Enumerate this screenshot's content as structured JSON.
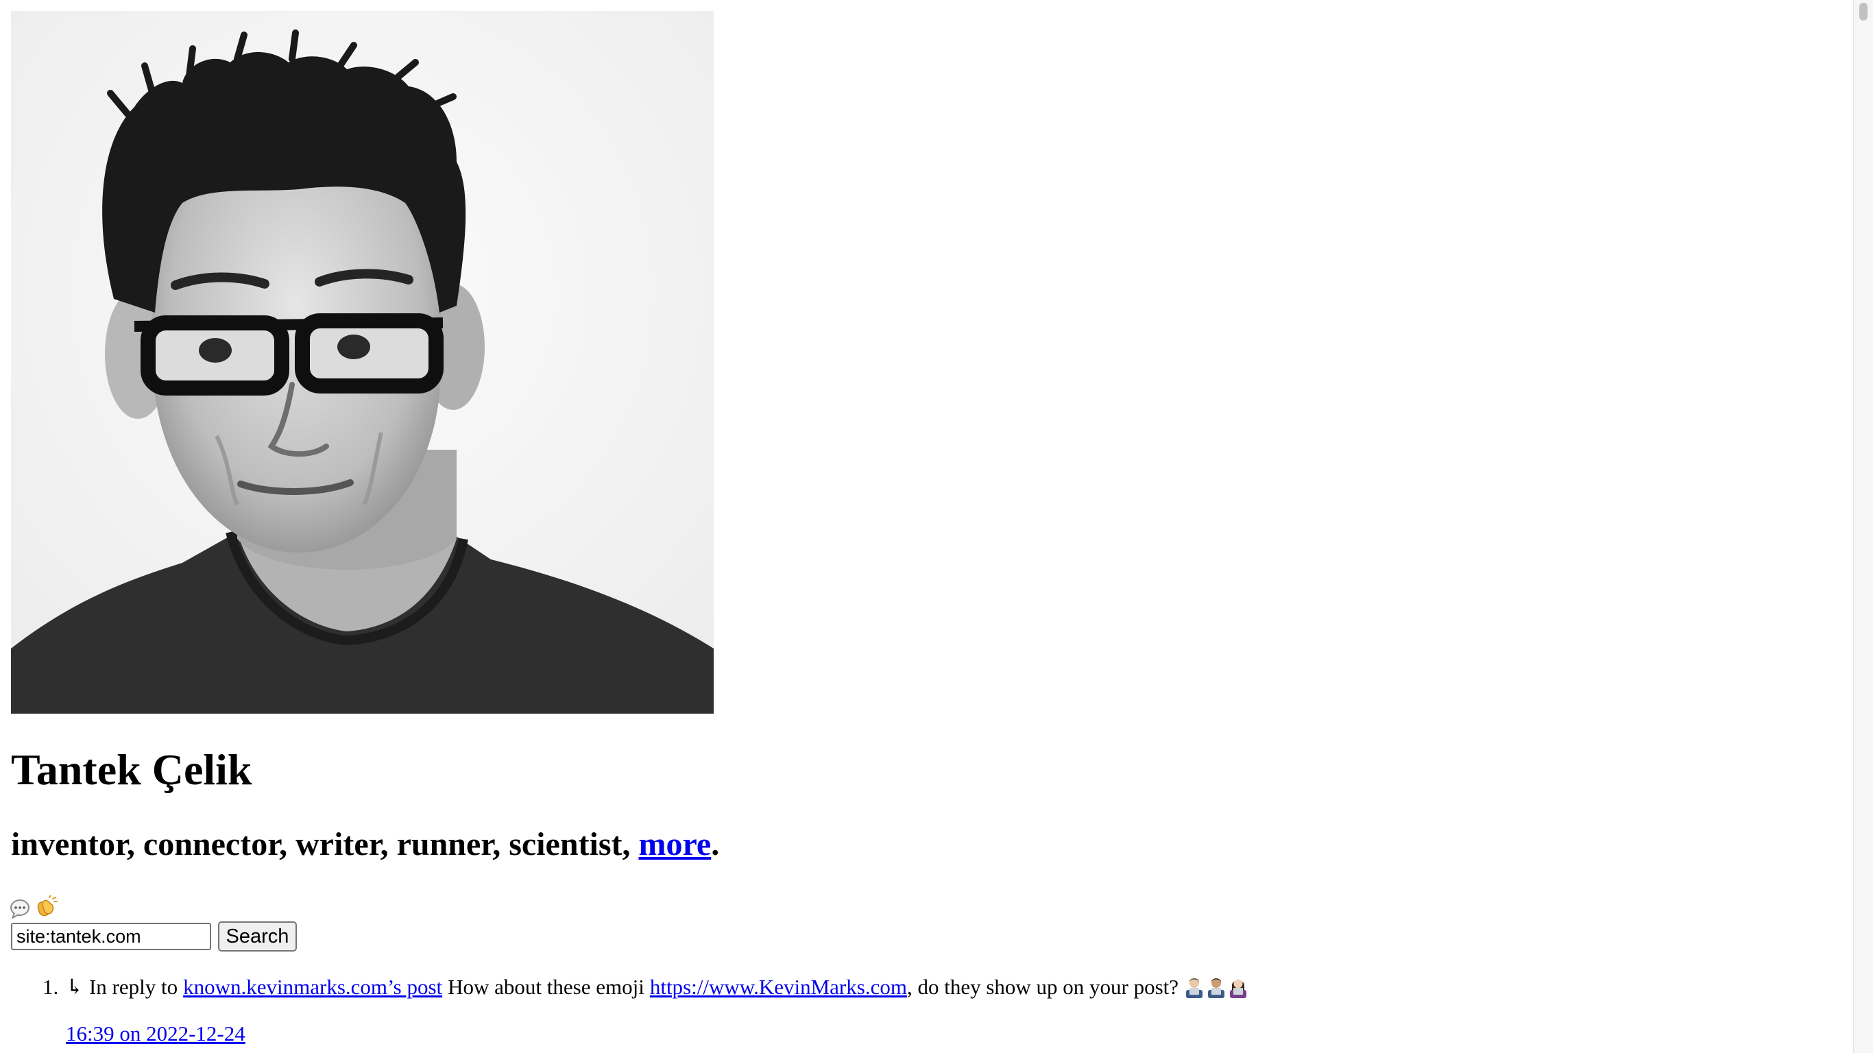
{
  "profile": {
    "name": "Tantek Çelik",
    "tagline_prefix": "inventor, connector, writer, runner, scientist, ",
    "tagline_link": "more",
    "tagline_suffix": "."
  },
  "icons": [
    "speech-bubble-icon",
    "clapping-hands-icon"
  ],
  "search": {
    "value": "site:tantek.com",
    "button_label": "Search"
  },
  "posts": [
    {
      "number": "1.",
      "reply_arrow": "↳",
      "reply_prefix": "In reply to",
      "reply_link": "known.kevinmarks.com’s post",
      "text_before_link": "How about these emoji",
      "inline_link": "https://www.KevinMarks.com",
      "text_after_link": ", do they show up on your post?",
      "emoji": [
        "man-technologist-icon",
        "man-technologist-icon",
        "woman-technologist-icon"
      ],
      "timestamp": "16:39 on 2022-12-24"
    }
  ]
}
